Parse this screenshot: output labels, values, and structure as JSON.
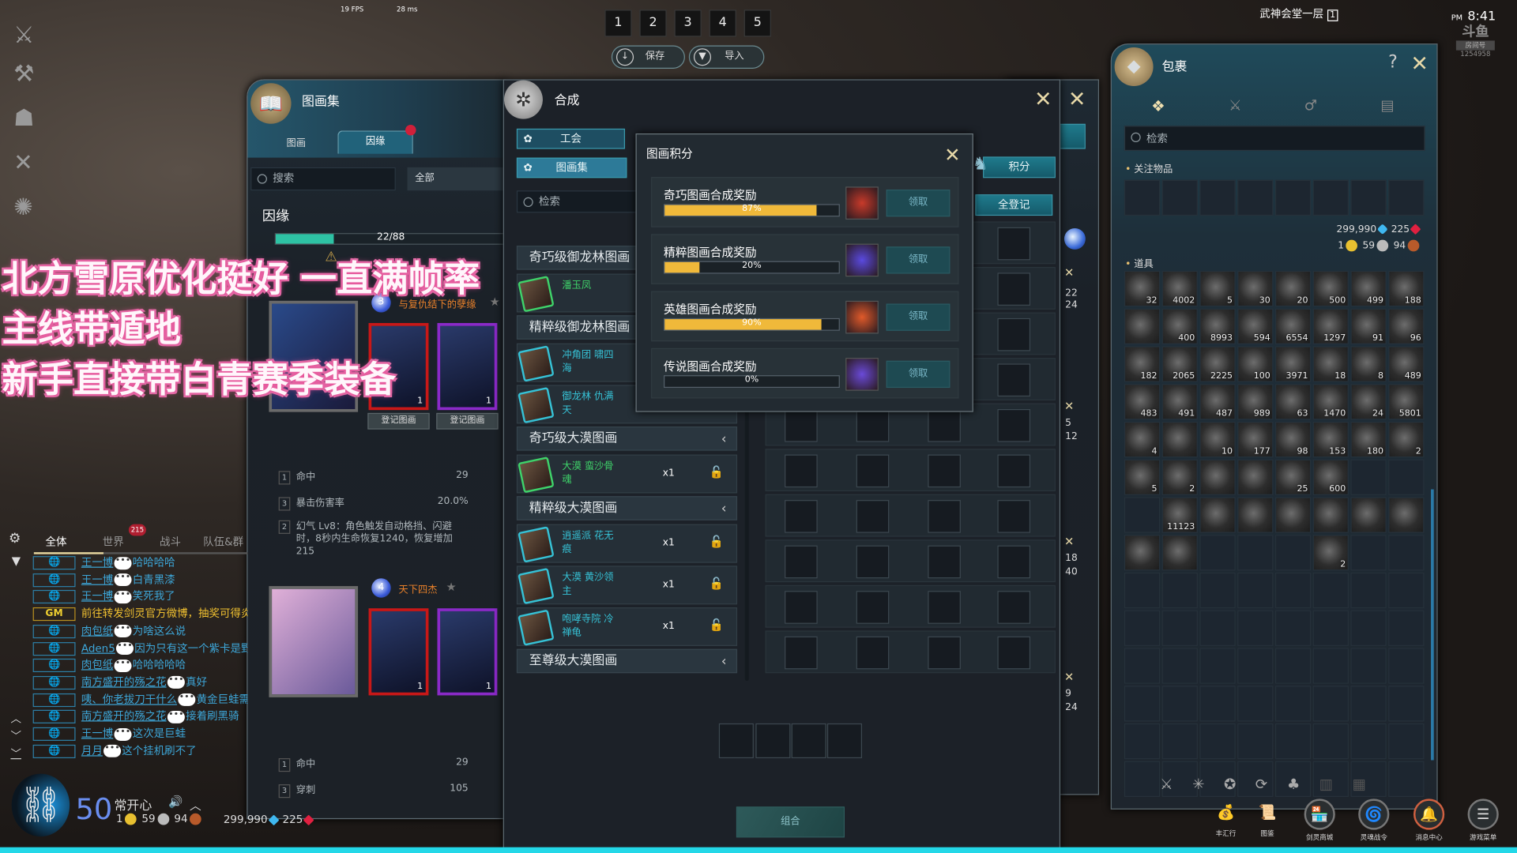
{
  "hud": {
    "fps": "19 FPS",
    "ping": "28 ms",
    "location": "武神会堂一层",
    "channel": "1",
    "time_period": "PM",
    "time": "8:41",
    "stream_room_label": "房间号",
    "stream_room": "1254958"
  },
  "presets": {
    "slots": [
      "1",
      "2",
      "3",
      "4",
      "5"
    ],
    "save": "保存",
    "import": "导入"
  },
  "captions": [
    "北方雪原优化挺好 一直满帧率",
    "主线带遁地",
    "新手直接带白青赛季装备"
  ],
  "collection": {
    "title": "图画集",
    "tabs": [
      "图画",
      "因缘"
    ],
    "active_tab": 1,
    "search_placeholder": "搜索",
    "filter": "全部",
    "section": "因缘",
    "progress_text": "22/88",
    "progress": 0.25,
    "groups": [
      {
        "level": "3",
        "name": "与复仇结下的孽缘",
        "cards": [
          {
            "count": "1",
            "rarity": "red"
          },
          {
            "count": "1",
            "rarity": "purple"
          }
        ],
        "register": "登记图画",
        "stats": [
          {
            "n": "1",
            "name": "命中",
            "value": "29"
          },
          {
            "n": "3",
            "name": "暴击伤害率",
            "value": "20.0%"
          },
          {
            "n": "2",
            "name": "幻气 Lv8：角色触发自动格挡、闪避时，8秒内生命恢复1240，恢复增加215",
            "value": ""
          }
        ]
      },
      {
        "level": "4",
        "name": "天下四杰",
        "cards": [
          {
            "count": "1",
            "rarity": "red"
          },
          {
            "count": "1",
            "rarity": "purple"
          }
        ],
        "stats": [
          {
            "n": "1",
            "name": "命中",
            "value": "29"
          },
          {
            "n": "3",
            "name": "穿刺",
            "value": "105"
          }
        ]
      }
    ]
  },
  "synthesis": {
    "title": "合成",
    "side_tabs": [
      "工会",
      "图画集"
    ],
    "search_placeholder": "检索",
    "points_button": "积分",
    "register_all_button": "全登记",
    "combine_button": "组合",
    "list": [
      {
        "type": "head",
        "label": "奇巧级御龙林图画"
      },
      {
        "type": "item",
        "name": "潘玉凤",
        "color": "#3fd36a",
        "qty": ""
      },
      {
        "type": "head",
        "label": "精粹级御龙林图画"
      },
      {
        "type": "item",
        "name": "冲角团 啸四海",
        "color": "#36c2d6",
        "qty": ""
      },
      {
        "type": "item",
        "name": "御龙林 仇满天",
        "color": "#36c2d6",
        "qty": ""
      },
      {
        "type": "head",
        "label": "奇巧级大漠图画"
      },
      {
        "type": "item",
        "name": "大漠 蛮沙骨魂",
        "color": "#3fd36a",
        "qty": "x1"
      },
      {
        "type": "head",
        "label": "精粹级大漠图画"
      },
      {
        "type": "item",
        "name": "逍遥派 花无痕",
        "color": "#36c2d6",
        "qty": "x1"
      },
      {
        "type": "item",
        "name": "大漠 黄沙领主",
        "color": "#36c2d6",
        "qty": "x1"
      },
      {
        "type": "item",
        "name": "咆哮寺院 冷禅龟",
        "color": "#36c2d6",
        "qty": "x1"
      },
      {
        "type": "head",
        "label": "至尊级大漠图画"
      }
    ],
    "side_numbers": [
      "22",
      "24",
      "5",
      "12",
      "18",
      "40",
      "9",
      "24"
    ]
  },
  "points_popup": {
    "title": "图画积分",
    "claim": "领取",
    "rows": [
      {
        "label": "奇巧图画合成奖励",
        "percent": 87,
        "text": "87%"
      },
      {
        "label": "精粹图画合成奖励",
        "percent": 20,
        "text": "20%"
      },
      {
        "label": "英雄图画合成奖励",
        "percent": 90,
        "text": "90%"
      },
      {
        "label": "传说图画合成奖励",
        "percent": 0,
        "text": "0%"
      }
    ]
  },
  "bag": {
    "title": "包裹",
    "help": "?",
    "search_placeholder": "检索",
    "watch_label": "关注物品",
    "items_label": "道具",
    "currency": {
      "diamond": "299,990",
      "red": "225",
      "gold": "1",
      "silver": "59",
      "copper": "94"
    },
    "items": [
      [
        "32",
        "4002",
        "5",
        "30",
        "20",
        "500",
        "499",
        "188"
      ],
      [
        "",
        "400",
        "8993",
        "594",
        "6554",
        "1297",
        "91",
        "96"
      ],
      [
        "182",
        "2065",
        "2225",
        "100",
        "3971",
        "18",
        "8",
        "489"
      ],
      [
        "483",
        "491",
        "487",
        "989",
        "63",
        "1470",
        "24",
        "5801"
      ],
      [
        "4",
        "",
        "10",
        "177",
        "98",
        "153",
        "180",
        "2"
      ],
      [
        "5",
        "2",
        "",
        "",
        "25",
        "600",
        null,
        null
      ],
      [
        null,
        "11123",
        "",
        "",
        "",
        "",
        "",
        ""
      ],
      [
        "",
        "",
        null,
        null,
        null,
        "2",
        null,
        null
      ]
    ]
  },
  "chat": {
    "tabs": [
      "全体",
      "世界",
      "战斗",
      "队伍&群"
    ],
    "world_badge": "215",
    "messages": [
      {
        "ch": "globe",
        "user": "王一博",
        "text": "哈哈哈哈"
      },
      {
        "ch": "globe",
        "user": "王一博",
        "text": "白青黑漆"
      },
      {
        "ch": "globe",
        "user": "王一博",
        "text": "笑死我了"
      },
      {
        "ch": "GM",
        "user": "",
        "text": "前往转发剑灵官方微博，抽奖可得炎"
      },
      {
        "ch": "globe",
        "user": "肉包纸",
        "text": "为啥这么说"
      },
      {
        "ch": "globe",
        "user": "Aden5",
        "text": "因为只有这一个紫卡是野"
      },
      {
        "ch": "globe",
        "user": "肉包纸",
        "text": "哈哈哈哈哈"
      },
      {
        "ch": "globe",
        "user": "南方盛开的殇之花",
        "text": "真好"
      },
      {
        "ch": "globe",
        "user": "咦、你老拔刀干什么",
        "text": "黄金巨蛙需"
      },
      {
        "ch": "globe",
        "user": "南方盛开的殇之花",
        "text": "接着刷黑骑"
      },
      {
        "ch": "globe",
        "user": "王一博",
        "text": "这次是巨蛙"
      },
      {
        "ch": "globe",
        "user": "月月",
        "text": "这个挂机刷不了"
      }
    ]
  },
  "player": {
    "level": "50",
    "name": "常开心",
    "gold": "1",
    "silver": "59",
    "copper": "94",
    "diamond": "299,990",
    "red": "225"
  },
  "menu": [
    "丰汇行",
    "图鉴",
    "剑灵商城",
    "灵魂战令",
    "消息中心",
    "游戏菜单"
  ],
  "colors": {
    "accent_teal": "#1f7a8c",
    "progress_gold": "#f0b93a",
    "bottom_bar": "#23d8e8",
    "caption_pink": "#e8559b"
  }
}
